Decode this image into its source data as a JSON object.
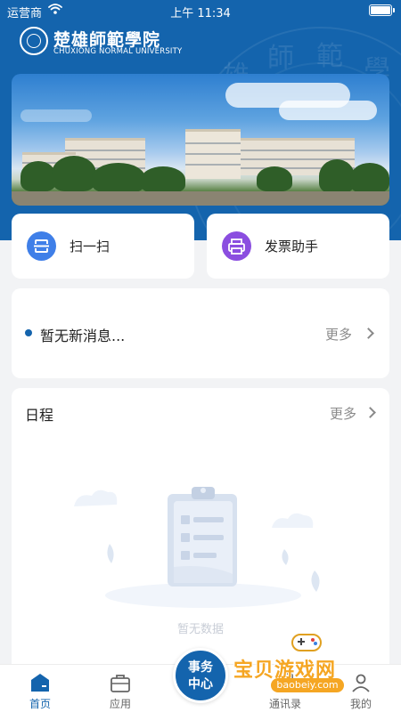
{
  "status_bar": {
    "carrier": "运营商",
    "time": "上午 11:34"
  },
  "header": {
    "school_name": "楚雄師範學院",
    "school_name_en": "CHUXIONG NORMAL UNIVERSITY",
    "background_color": "#1464ad",
    "watermark_chars": [
      "雄",
      "師",
      "範",
      "學"
    ]
  },
  "quick_actions": [
    {
      "label": "扫一扫",
      "icon": "scan-icon",
      "color": "#3f7fe8"
    },
    {
      "label": "发票助手",
      "icon": "printer-icon",
      "color": "#8b4ee0"
    }
  ],
  "messages": {
    "text": "暂无新消息...",
    "more": "更多"
  },
  "schedule": {
    "title": "日程",
    "more": "更多",
    "empty_text": "暂无数据"
  },
  "tabbar": {
    "tabs": [
      {
        "label": "首页",
        "icon": "home-icon",
        "active": true
      },
      {
        "label": "应用",
        "icon": "briefcase-icon",
        "active": false
      },
      {
        "label": "通讯录",
        "icon": "contacts-icon",
        "active": false
      },
      {
        "label": "我的",
        "icon": "person-icon",
        "active": false
      }
    ],
    "center_button": {
      "line1": "事务",
      "line2": "中心"
    },
    "accent_color": "#1464ad"
  },
  "overlay_watermark": {
    "text": "宝贝游戏网",
    "url": "baobeiy.com"
  }
}
